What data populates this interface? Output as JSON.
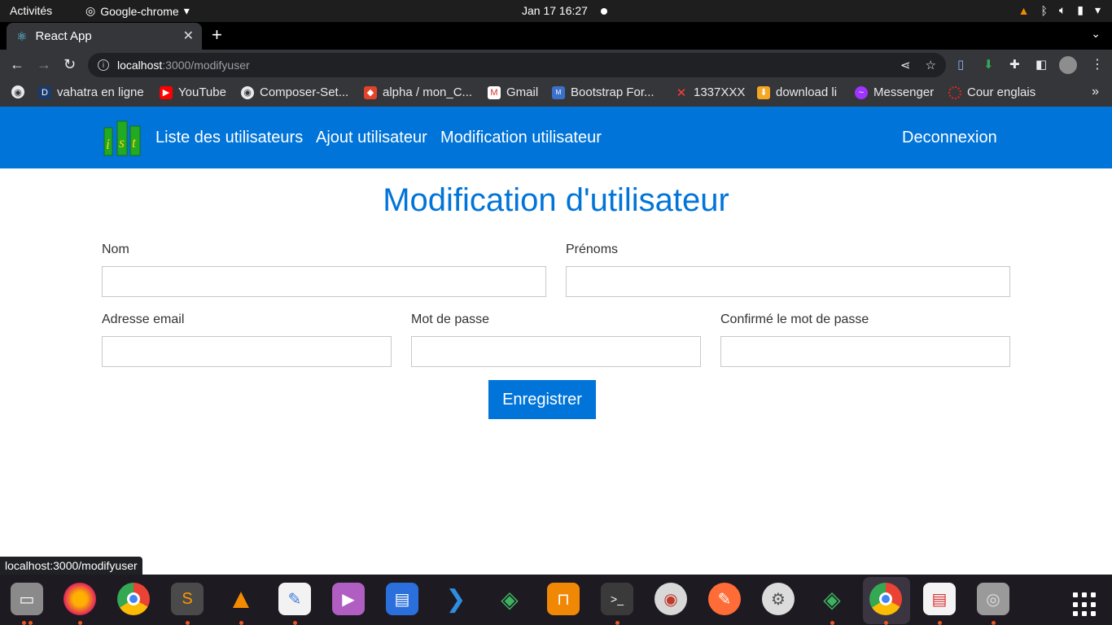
{
  "system_bar": {
    "activities": "Activités",
    "app_menu": "Google-chrome",
    "clock": "Jan 17  16:27"
  },
  "browser": {
    "tab_title": "React App",
    "url_host": "localhost",
    "url_path": ":3000/modifyuser",
    "bookmarks": [
      "vahatra en ligne",
      "YouTube",
      "Composer-Set...",
      "alpha / mon_C...",
      "Gmail",
      "Bootstrap For...",
      "1337XXX",
      "download li",
      "Messenger",
      "Cour englais"
    ],
    "status_url": "localhost:3000/modifyuser"
  },
  "app_nav": {
    "links": [
      "Liste des utilisateurs",
      "Ajout utilisateur",
      "Modification utilisateur"
    ],
    "logout": "Deconnexion",
    "accent": "#0074d9"
  },
  "form": {
    "title": "Modification d'utilisateur",
    "nom_label": "Nom",
    "nom_value": "",
    "prenoms_label": "Prénoms",
    "prenoms_value": "",
    "email_label": "Adresse email",
    "email_value": "",
    "password_label": "Mot de passe",
    "password_value": "",
    "confirm_label": "Confirmé le mot de passe",
    "confirm_value": "",
    "submit_label": "Enregistrer"
  },
  "dock": {
    "apps": [
      "files-icon",
      "firefox-icon",
      "chrome-icon",
      "sublime-icon",
      "vlc-icon",
      "text-editor-icon",
      "video-icon",
      "document-icon",
      "vscode-icon",
      "robo3t-icon",
      "drawio-icon",
      "terminal-icon",
      "vpn-icon",
      "postman-icon",
      "settings-icon",
      "robo3t-icon-2",
      "chrome-active-icon",
      "text-viewer-icon",
      "disk-icon"
    ]
  }
}
